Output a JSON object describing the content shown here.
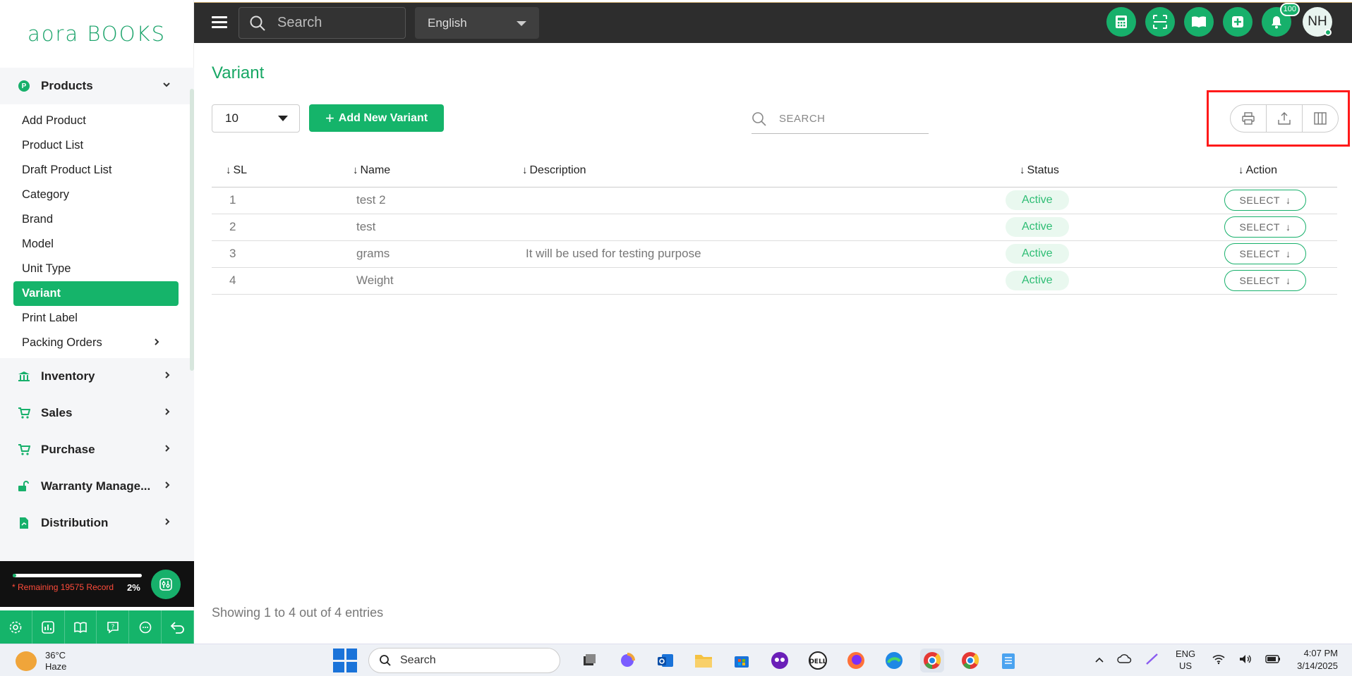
{
  "app": {
    "logo": "aora BOOKS",
    "accent": "#15b46a"
  },
  "topbar": {
    "search_placeholder": "Search",
    "language": "English",
    "actions": [
      "calculator-icon",
      "scan-icon",
      "book-icon",
      "add-icon",
      "bell-icon"
    ],
    "notification_count": "100",
    "user_initials": "NH"
  },
  "sidebar": {
    "products_group": "Products",
    "product_items": [
      {
        "label": "Add Product"
      },
      {
        "label": "Product List"
      },
      {
        "label": "Draft Product List"
      },
      {
        "label": "Category"
      },
      {
        "label": "Brand"
      },
      {
        "label": "Model"
      },
      {
        "label": "Unit Type"
      },
      {
        "label": "Variant",
        "active": true
      },
      {
        "label": "Print Label"
      },
      {
        "label": "Packing Orders"
      }
    ],
    "groups": [
      {
        "label": "Inventory",
        "icon": "bank-icon"
      },
      {
        "label": "Sales",
        "icon": "cart-icon"
      },
      {
        "label": "Purchase",
        "icon": "cart-icon"
      },
      {
        "label": "Warranty Manage...",
        "icon": "unlock-icon"
      },
      {
        "label": "Distribution",
        "icon": "file-icon"
      }
    ],
    "record": {
      "text": "* Remaining 19575 Record",
      "percent": "2%",
      "progress": 0.02
    },
    "bottom_icons": [
      "settings-icon",
      "chart-icon",
      "guide-book-icon",
      "help-icon",
      "chat-icon",
      "back-icon"
    ]
  },
  "main": {
    "title": "Variant",
    "per_page": "10",
    "add_button": "Add New Variant",
    "search_placeholder": "SEARCH",
    "columns": [
      "SL",
      "Name",
      "Description",
      "Status",
      "Action"
    ],
    "rows": [
      {
        "sl": "1",
        "name": "test 2",
        "description": "",
        "status": "Active",
        "action": "SELECT"
      },
      {
        "sl": "2",
        "name": "test",
        "description": "",
        "status": "Active",
        "action": "SELECT"
      },
      {
        "sl": "3",
        "name": "grams",
        "description": "It will be used for testing purpose",
        "status": "Active",
        "action": "SELECT"
      },
      {
        "sl": "4",
        "name": "Weight",
        "description": "",
        "status": "Active",
        "action": "SELECT"
      }
    ],
    "footer": "Showing 1 to 4 out of 4 entries"
  },
  "taskbar": {
    "temp": "36°C",
    "weather": "Haze",
    "search": "Search",
    "lang1": "ENG",
    "lang2": "US",
    "time": "4:07 PM",
    "date": "3/14/2025"
  }
}
